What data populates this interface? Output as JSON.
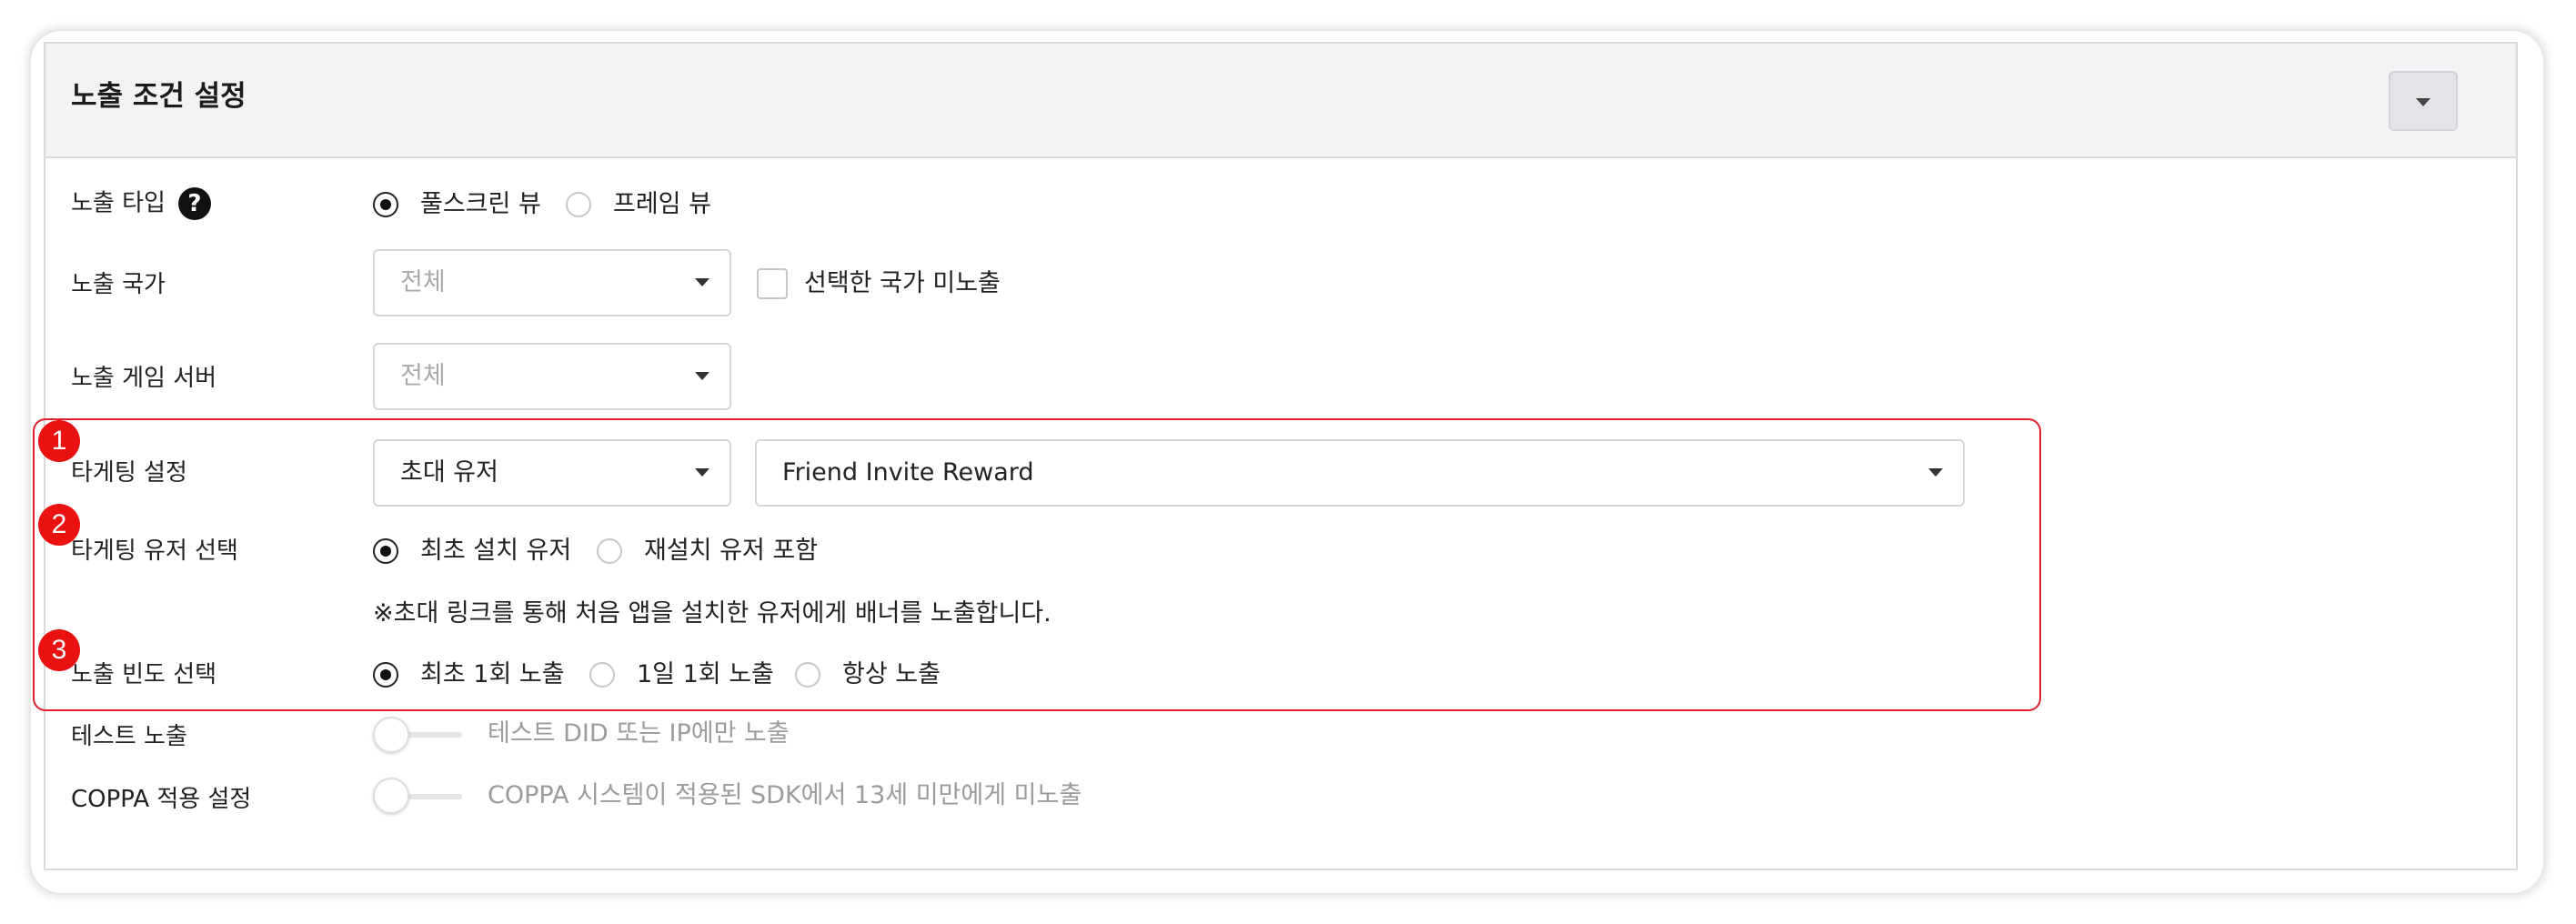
{
  "header": {
    "title": "노출 조건 설정"
  },
  "rows": {
    "exposure_type": {
      "label": "노출 타입",
      "help_icon": "?",
      "options": [
        {
          "label": "풀스크린 뷰",
          "checked": true
        },
        {
          "label": "프레임 뷰",
          "checked": false
        }
      ]
    },
    "exposure_country": {
      "label": "노출 국가",
      "select_value": "전체",
      "checkbox_label": "선택한 국가 미노출",
      "checkbox_checked": false
    },
    "exposure_server": {
      "label": "노출 게임 서버",
      "select_value": "전체"
    },
    "targeting": {
      "label": "타게팅 설정",
      "select_type": "초대 유저",
      "select_event": "Friend Invite Reward"
    },
    "target_user": {
      "label": "타게팅 유저 선택",
      "options": [
        {
          "label": "최초 설치 유저",
          "checked": true
        },
        {
          "label": "재설치 유저 포함",
          "checked": false
        }
      ],
      "note": "※초대 링크를 통해 처음 앱을 설치한 유저에게 배너를 노출합니다."
    },
    "frequency": {
      "label": "노출 빈도 선택",
      "options": [
        {
          "label": "최초 1회 노출",
          "checked": true
        },
        {
          "label": "1일 1회 노출",
          "checked": false
        },
        {
          "label": "항상 노출",
          "checked": false
        }
      ]
    },
    "test_exposure": {
      "label": "테스트 노출",
      "toggle_text": "테스트 DID 또는 IP에만 노출",
      "enabled": false
    },
    "coppa": {
      "label": "COPPA 적용 설정",
      "toggle_text": "COPPA 시스템이 적용된 SDK에서 13세 미만에게 미노출",
      "enabled": false
    }
  },
  "annotations": {
    "badges": [
      "1",
      "2",
      "3"
    ],
    "color": "#e0202a"
  },
  "icons": {
    "collapse": "caret-down-icon",
    "help": "question-circle-icon"
  }
}
